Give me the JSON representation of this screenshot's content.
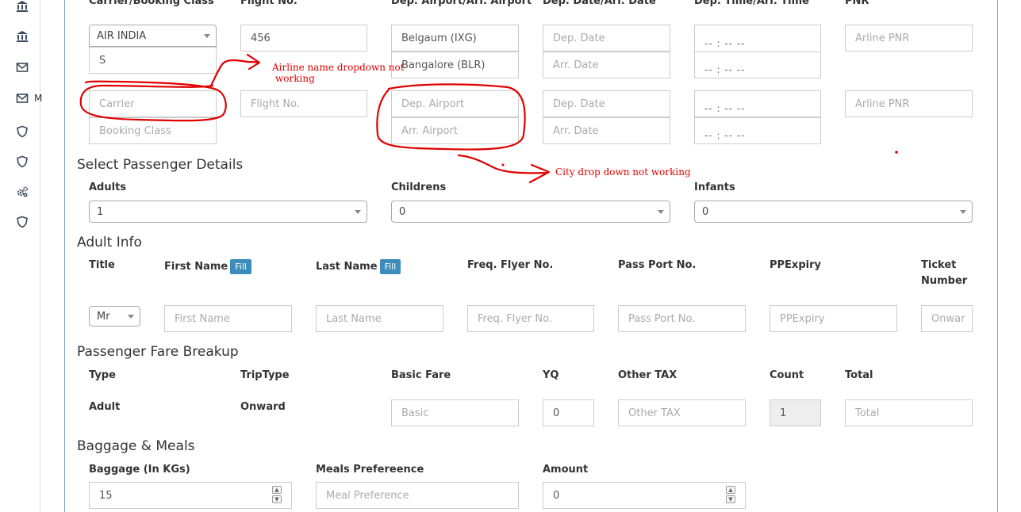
{
  "sidebar": {
    "icons": [
      "bank-icon",
      "bank-icon",
      "envelope-icon",
      "envelope-icon",
      "shield-icon",
      "shield-icon",
      "cogs-icon",
      "shield-icon"
    ],
    "truncated_label": "M"
  },
  "flight": {
    "headers": {
      "carrier": "Carrier/Booking Class",
      "flight_no": "Flight No.",
      "airports": "Dep. Airport/Arr. Airport",
      "dates": "Dep. Date/Arr. Date",
      "times": "Dep. Time/Arr. Time",
      "pnr": "PNR"
    },
    "row1": {
      "carrier_select": "AIR INDIA",
      "carrier_search": "S",
      "flight_no": "456",
      "dep_airport": "Belgaum (IXG)",
      "arr_airport": "Bangalore (BLR)",
      "dep_date_ph": "Dep. Date",
      "arr_date_ph": "Arr. Date",
      "dep_time": "-- : --  --",
      "arr_time": "-- : --  --",
      "pnr_ph": "Arline PNR"
    },
    "row2": {
      "carrier_ph": "Carrier",
      "booking_class_ph": "Booking Class",
      "flight_no_ph": "Flight No.",
      "dep_airport_ph": "Dep. Airport",
      "arr_airport_ph": "Arr. Airport",
      "dep_date_ph": "Dep. Date",
      "arr_date_ph": "Arr. Date",
      "dep_time": "-- : --  --",
      "arr_time": "-- : --  --",
      "pnr_ph": "Arline PNR"
    }
  },
  "passenger_details": {
    "title": "Select Passenger Details",
    "adults_label": "Adults",
    "adults_value": "1",
    "childrens_label": "Childrens",
    "childrens_value": "0",
    "infants_label": "Infants",
    "infants_value": "0"
  },
  "adult_info": {
    "title": "Adult Info",
    "headers": {
      "title": "Title",
      "first_name": "First Name",
      "last_name": "Last Name",
      "freq_flyer": "Freq. Flyer No.",
      "passport": "Pass Port No.",
      "ppexpiry": "PPExpiry",
      "ticket_line1": "Ticket",
      "ticket_line2": "Number"
    },
    "fill_label": "Fill",
    "title_value": "Mr",
    "first_name_ph": "First Name",
    "last_name_ph": "Last Name",
    "freq_flyer_ph": "Freq. Flyer No.",
    "passport_ph": "Pass Port No.",
    "ppexpiry_ph": "PPExpiry",
    "ticket_ph": "Onwar"
  },
  "fare": {
    "title": "Passenger Fare Breakup",
    "headers": {
      "type": "Type",
      "trip_type": "TripType",
      "basic_fare": "Basic Fare",
      "yq": "YQ",
      "other_tax": "Other TAX",
      "count": "Count",
      "total": "Total"
    },
    "row": {
      "type": "Adult",
      "trip_type": "Onward",
      "basic_ph": "Basic",
      "yq": "0",
      "other_tax_ph": "Other TAX",
      "count": "1",
      "total_ph": "Total"
    }
  },
  "baggage": {
    "title": "Baggage & Meals",
    "baggage_label": "Baggage (In KGs)",
    "baggage_value": "15",
    "meals_label": "Meals Prefereence",
    "meals_ph": "Meal Preference",
    "amount_label": "Amount",
    "amount_value": "0"
  },
  "annotations": {
    "airline_note_line1": "Airline name dropdown not",
    "airline_note_line2": "working",
    "city_note": "City drop down not working",
    "color": "#e00000"
  }
}
